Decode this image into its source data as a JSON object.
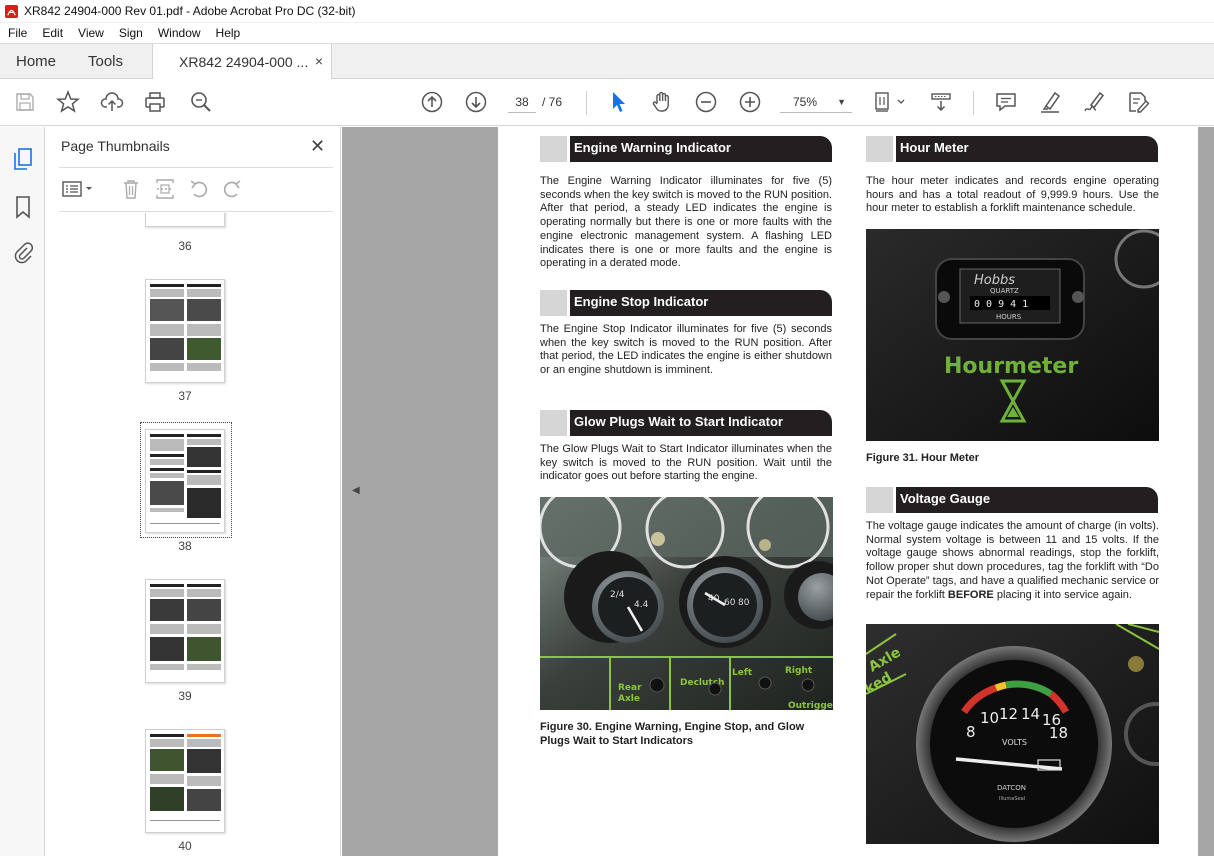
{
  "window": {
    "title": "XR842 24904-000 Rev 01.pdf - Adobe Acrobat Pro DC (32-bit)"
  },
  "menu": [
    "File",
    "Edit",
    "View",
    "Sign",
    "Window",
    "Help"
  ],
  "tabs": {
    "home": "Home",
    "tools": "Tools",
    "document": "XR842 24904-000 ...",
    "close_glyph": "×"
  },
  "toolbar": {
    "current_page": "38",
    "page_total": "/  76",
    "zoom": "75%",
    "zoom_caret": "▼",
    "icons": [
      "save-icon",
      "bookmark-star-icon",
      "upload-icon",
      "print-icon",
      "zoom-search-icon",
      "prev-page-icon",
      "next-page-icon",
      "select-cursor-icon",
      "hand-icon",
      "zoom-out-icon",
      "zoom-in-icon",
      "page-fit-icon",
      "scroll-mode-icon",
      "comment-icon",
      "highlight-icon",
      "sign-icon",
      "edit-pdf-icon"
    ]
  },
  "panel": {
    "title": "Page Thumbnails",
    "close_glyph": "✕",
    "thumbnails": [
      {
        "label": "36"
      },
      {
        "label": "37"
      },
      {
        "label": "38",
        "selected": true
      },
      {
        "label": "39"
      },
      {
        "label": "40"
      }
    ]
  },
  "document": {
    "sections": {
      "engine_warning": {
        "heading": "Engine Warning Indicator",
        "body": "The Engine Warning Indicator illuminates for five (5) seconds when the key switch is moved to the RUN position.  After that period, a steady LED indicates the engine is operating normally but there is one or more faults with the engine electronic management system.  A flashing LED indicates there is one or more faults and the engine is operating in a derated mode."
      },
      "engine_stop": {
        "heading": "Engine Stop Indicator",
        "body": "The Engine Stop Indicator illuminates for five (5) seconds when the key switch is moved to the RUN position. After that period, the LED indicates the engine is either shutdown or an engine shutdown is imminent."
      },
      "glow_plugs": {
        "heading": "Glow Plugs Wait to Start Indicator",
        "body": "The Glow Plugs Wait to Start Indicator illuminates when the key switch is moved to the RUN position.  Wait until the indicator goes out before starting the engine."
      },
      "figure30": {
        "caption": "Figure 30.  Engine Warning, Engine Stop, and Glow Plugs Wait to Start Indicators",
        "photo_labels": {
          "left": "Left",
          "right": "Right",
          "rear": "Rear Axle Centered",
          "outriggers": "Outriggers",
          "declutch": "Declutch"
        }
      },
      "hour_meter": {
        "heading": "Hour Meter",
        "body": "The hour meter indicates and records engine operating hours and has a total readout of 9,999.9 hours. Use the hour meter to establish a forklift maintenance schedule."
      },
      "figure31": {
        "caption": "Figure 31.  Hour Meter",
        "photo_labels": {
          "brand": "Hobbs",
          "quartz": "QUARTZ",
          "digits": "0 0 9 4 1",
          "hours": "HOURS",
          "sign": "Hourmeter"
        }
      },
      "voltage": {
        "heading": "Voltage Gauge",
        "body_pre": "The voltage gauge indicates the amount of charge (in volts). Normal system voltage is between 11 and 15 volts. If the voltage gauge shows abnormal readings, stop the forklift, follow proper shut down procedures, tag the forklift with “Do Not Operate” tags, and have a qualified mechanic service or repair the forklift ",
        "body_bold": "BEFORE",
        "body_post": " placing it into service again.",
        "photo_labels": {
          "ticks": [
            "8",
            "10",
            "12",
            "14",
            "16",
            "18"
          ],
          "unit": "VOLTS",
          "brand": "DATCON",
          "sub": "IllumaSeal",
          "axle": "Axle",
          "locked": "ked"
        }
      }
    }
  },
  "colors": {
    "heading_bar": "#231f20",
    "heading_box": "#d6d6d6",
    "doc_background": "#a6a6a6",
    "acrobat_red": "#d6201f"
  }
}
